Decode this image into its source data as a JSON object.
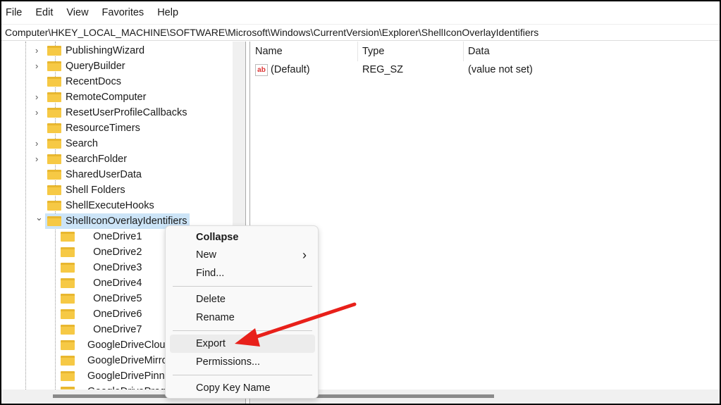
{
  "menu": [
    "File",
    "Edit",
    "View",
    "Favorites",
    "Help"
  ],
  "address": "Computer\\HKEY_LOCAL_MACHINE\\SOFTWARE\\Microsoft\\Windows\\CurrentVersion\\Explorer\\ShellIconOverlayIdentifiers",
  "tree": [
    {
      "label": "PublishingWizard",
      "expandable": true
    },
    {
      "label": "QueryBuilder",
      "expandable": true
    },
    {
      "label": "RecentDocs",
      "expandable": false
    },
    {
      "label": "RemoteComputer",
      "expandable": true
    },
    {
      "label": "ResetUserProfileCallbacks",
      "expandable": true
    },
    {
      "label": "ResourceTimers",
      "expandable": false
    },
    {
      "label": "Search",
      "expandable": true
    },
    {
      "label": "SearchFolder",
      "expandable": true
    },
    {
      "label": "SharedUserData",
      "expandable": false
    },
    {
      "label": "Shell Folders",
      "expandable": false
    },
    {
      "label": "ShellExecuteHooks",
      "expandable": false
    },
    {
      "label": "ShellIconOverlayIdentifiers",
      "expandable": true,
      "selected": true
    }
  ],
  "children": [
    "   OneDrive1",
    "   OneDrive2",
    "   OneDrive3",
    "   OneDrive4",
    "   OneDrive5",
    "   OneDrive6",
    "   OneDrive7",
    " GoogleDriveCloudFiles",
    " GoogleDriveMirror",
    " GoogleDrivePinned",
    " GoogleDriveProgress"
  ],
  "columns": {
    "name": "Name",
    "type": "Type",
    "data": "Data"
  },
  "values": [
    {
      "icon": "ab",
      "name": "(Default)",
      "type": "REG_SZ",
      "data": "(value not set)"
    }
  ],
  "context_menu": {
    "collapse": "Collapse",
    "new": "New",
    "new_arrow": "›",
    "find": "Find...",
    "delete": "Delete",
    "rename": "Rename",
    "export": "Export",
    "permissions": "Permissions...",
    "copy": "Copy Key Name"
  },
  "colors": {
    "arrow": "#e8201a",
    "selection": "#cce4f7"
  }
}
